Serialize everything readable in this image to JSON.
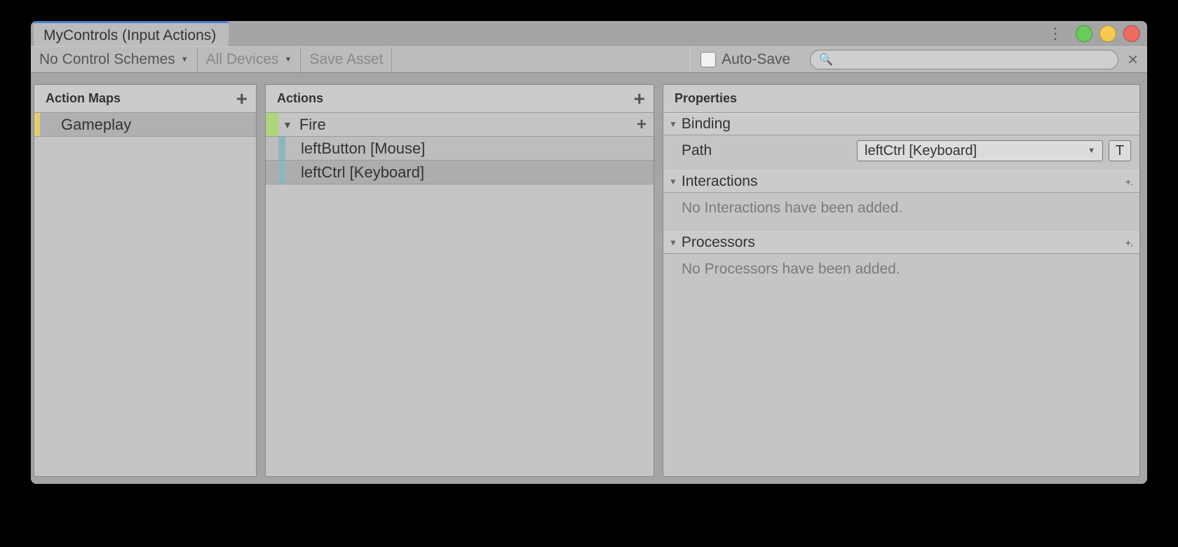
{
  "window": {
    "title": "MyControls (Input Actions)"
  },
  "toolbar": {
    "control_schemes": "No Control Schemes",
    "devices": "All Devices",
    "save_asset": "Save Asset",
    "auto_save": "Auto-Save",
    "search_placeholder": ""
  },
  "panels": {
    "action_maps": {
      "title": "Action Maps"
    },
    "actions": {
      "title": "Actions"
    },
    "properties": {
      "title": "Properties"
    }
  },
  "action_maps": [
    {
      "label": "Gameplay"
    }
  ],
  "actions": {
    "name": "Fire",
    "bindings": [
      {
        "label": "leftButton [Mouse]",
        "selected": false
      },
      {
        "label": "leftCtrl [Keyboard]",
        "selected": true
      }
    ]
  },
  "properties": {
    "binding": {
      "header": "Binding",
      "path_label": "Path",
      "path_value": "leftCtrl [Keyboard]",
      "t_button": "T"
    },
    "interactions": {
      "header": "Interactions",
      "empty": "No Interactions have been added."
    },
    "processors": {
      "header": "Processors",
      "empty": "No Processors have been added."
    }
  }
}
